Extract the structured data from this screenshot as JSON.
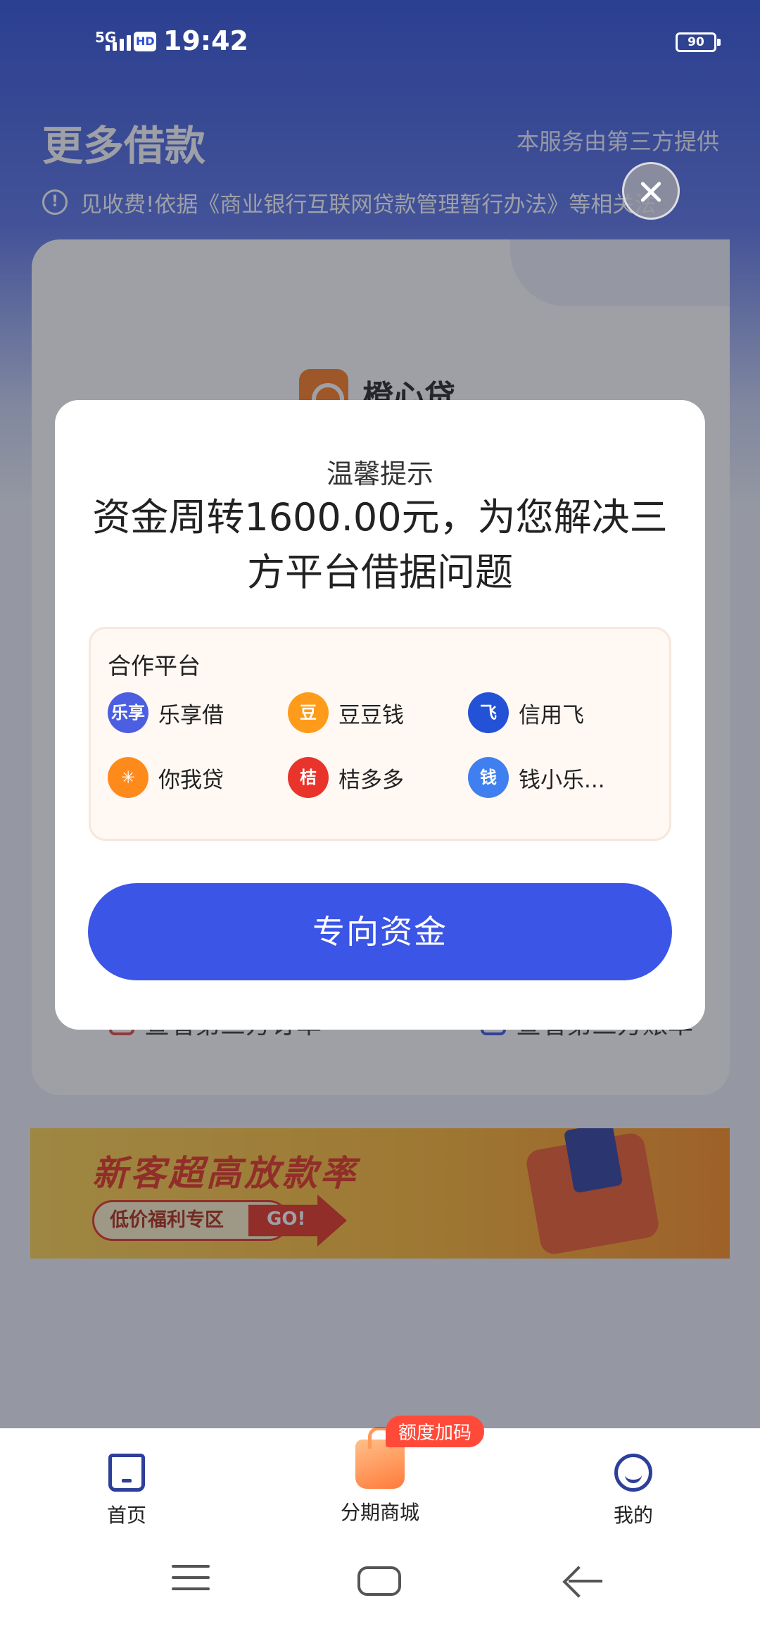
{
  "status_bar": {
    "network": "5G",
    "hd": "HD",
    "time": "19:42",
    "battery": "90"
  },
  "header": {
    "title": "更多借款",
    "provider_note": "本服务由第三方提供",
    "notice_icon": "info-icon",
    "notice_text": "见收费!依据《商业银行互联网贷款管理暂行办法》等相关法"
  },
  "card": {
    "brand_name": "橙心贷",
    "link_left": "查看第三方订单",
    "link_right": "查看第三方账单"
  },
  "banner": {
    "title": "新客超高放款率",
    "pill": "低价福利专区",
    "go": "GO!"
  },
  "bottom_nav": {
    "items": [
      {
        "label": "首页",
        "icon": "home-icon"
      },
      {
        "label": "分期商城",
        "icon": "shopping-bag-icon",
        "badge": "额度加码"
      },
      {
        "label": "我的",
        "icon": "profile-icon"
      }
    ]
  },
  "dialog": {
    "subtitle": "温馨提示",
    "title": "资金周转1600.00元，为您解决三方平台借据问题",
    "partners_heading": "合作平台",
    "partners": [
      {
        "name": "乐享借",
        "logo_text": "乐享",
        "color": "#4b5fe0"
      },
      {
        "name": "豆豆钱",
        "logo_text": "豆",
        "color": "#ff9b1a"
      },
      {
        "name": "信用飞",
        "logo_text": "飞",
        "color": "#2452d6"
      },
      {
        "name": "你我贷",
        "logo_text": "✳",
        "color": "#ff8a1c"
      },
      {
        "name": "桔多多",
        "logo_text": "桔",
        "color": "#e8342a"
      },
      {
        "name": "钱小乐...",
        "logo_text": "钱",
        "color": "#3f7ff0"
      }
    ],
    "cta_label": "专向资金"
  },
  "colors": {
    "primary": "#3b55e6",
    "header_gradient_top": "#2f4fd8"
  }
}
